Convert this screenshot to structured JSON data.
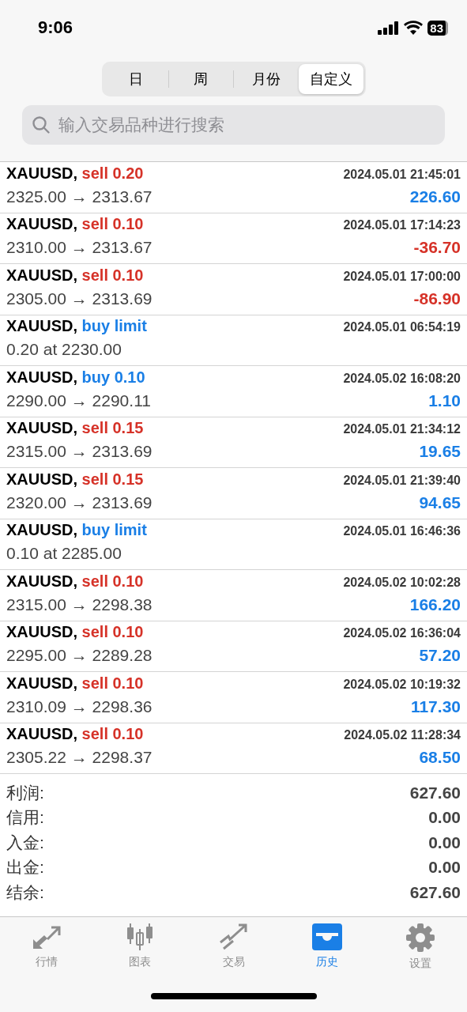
{
  "status_bar": {
    "time": "9:06",
    "battery": "83"
  },
  "period_tabs": [
    {
      "label": "日",
      "selected": false
    },
    {
      "label": "周",
      "selected": false
    },
    {
      "label": "月份",
      "selected": false
    },
    {
      "label": "自定义",
      "selected": true
    }
  ],
  "search": {
    "placeholder": "输入交易品种进行搜索"
  },
  "history": [
    {
      "symbol": "XAUUSD,",
      "kind": "sell",
      "action": "sell 0.20",
      "time": "2024.05.01 21:45:01",
      "prices": "2325.00 → 2313.67",
      "profit": "226.60",
      "loss": false
    },
    {
      "symbol": "XAUUSD,",
      "kind": "sell",
      "action": "sell 0.10",
      "time": "2024.05.01 17:14:23",
      "prices": "2310.00 → 2313.67",
      "profit": "-36.70",
      "loss": true
    },
    {
      "symbol": "XAUUSD,",
      "kind": "sell",
      "action": "sell 0.10",
      "time": "2024.05.01 17:00:00",
      "prices": "2305.00 → 2313.69",
      "profit": "-86.90",
      "loss": true
    },
    {
      "symbol": "XAUUSD,",
      "kind": "buy",
      "action": "buy limit",
      "time": "2024.05.01 06:54:19",
      "prices": "0.20 at 2230.00"
    },
    {
      "symbol": "XAUUSD,",
      "kind": "buy",
      "action": "buy 0.10",
      "time": "2024.05.02 16:08:20",
      "prices": "2290.00 → 2290.11",
      "profit": "1.10",
      "loss": false
    },
    {
      "symbol": "XAUUSD,",
      "kind": "sell",
      "action": "sell 0.15",
      "time": "2024.05.01 21:34:12",
      "prices": "2315.00 → 2313.69",
      "profit": "19.65",
      "loss": false
    },
    {
      "symbol": "XAUUSD,",
      "kind": "sell",
      "action": "sell 0.15",
      "time": "2024.05.01 21:39:40",
      "prices": "2320.00 → 2313.69",
      "profit": "94.65",
      "loss": false
    },
    {
      "symbol": "XAUUSD,",
      "kind": "buy",
      "action": "buy limit",
      "time": "2024.05.01 16:46:36",
      "prices": "0.10 at 2285.00"
    },
    {
      "symbol": "XAUUSD,",
      "kind": "sell",
      "action": "sell 0.10",
      "time": "2024.05.02 10:02:28",
      "prices": "2315.00 → 2298.38",
      "profit": "166.20",
      "loss": false
    },
    {
      "symbol": "XAUUSD,",
      "kind": "sell",
      "action": "sell 0.10",
      "time": "2024.05.02 16:36:04",
      "prices": "2295.00 → 2289.28",
      "profit": "57.20",
      "loss": false
    },
    {
      "symbol": "XAUUSD,",
      "kind": "sell",
      "action": "sell 0.10",
      "time": "2024.05.02 10:19:32",
      "prices": "2310.09 → 2298.36",
      "profit": "117.30",
      "loss": false
    },
    {
      "symbol": "XAUUSD,",
      "kind": "sell",
      "action": "sell 0.10",
      "time": "2024.05.02 11:28:34",
      "prices": "2305.22 → 2298.37",
      "profit": "68.50",
      "loss": false
    }
  ],
  "summary": [
    {
      "label": "利润:",
      "value": "627.60"
    },
    {
      "label": "信用:",
      "value": "0.00"
    },
    {
      "label": "入金:",
      "value": "0.00"
    },
    {
      "label": "出金:",
      "value": "0.00"
    },
    {
      "label": "结余:",
      "value": "627.60"
    }
  ],
  "tab_bar": [
    {
      "kind": "arrows",
      "label": "行情",
      "selected": false
    },
    {
      "kind": "candles",
      "label": "图表",
      "selected": false
    },
    {
      "kind": "trend",
      "label": "交易",
      "selected": false
    },
    {
      "kind": "tray",
      "label": "历史",
      "selected": true
    },
    {
      "kind": "gear",
      "label": "设置",
      "selected": false
    }
  ]
}
